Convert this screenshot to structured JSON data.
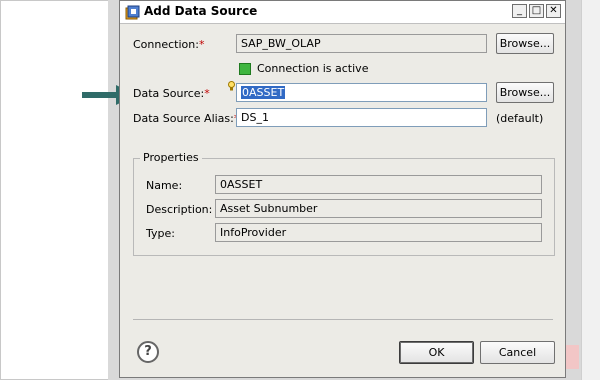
{
  "dialog": {
    "title": "Add Data Source",
    "window_controls": {
      "minimize": "_",
      "maximize": "□",
      "close": "✕"
    }
  },
  "form": {
    "connection_label": "Connection:",
    "connection_value": "SAP_BW_OLAP",
    "connection_browse": "Browse...",
    "connection_status": "Connection is active",
    "datasource_label": "Data Source:",
    "datasource_value": "0ASSET",
    "datasource_browse": "Browse...",
    "alias_label": "Data Source Alias:",
    "alias_value": "DS_1",
    "alias_note": "(default)",
    "required_mark": "*"
  },
  "properties": {
    "title": "Properties",
    "name_label": "Name:",
    "name_value": "0ASSET",
    "description_label": "Description:",
    "description_value": "Asset Subnumber",
    "type_label": "Type:",
    "type_value": "InfoProvider"
  },
  "footer": {
    "help": "?",
    "ok": "OK",
    "cancel": "Cancel"
  },
  "colors": {
    "status": "#3fb53f",
    "required": "#c00000",
    "arrow": "#2f6b68",
    "selection": "#316ac5"
  }
}
